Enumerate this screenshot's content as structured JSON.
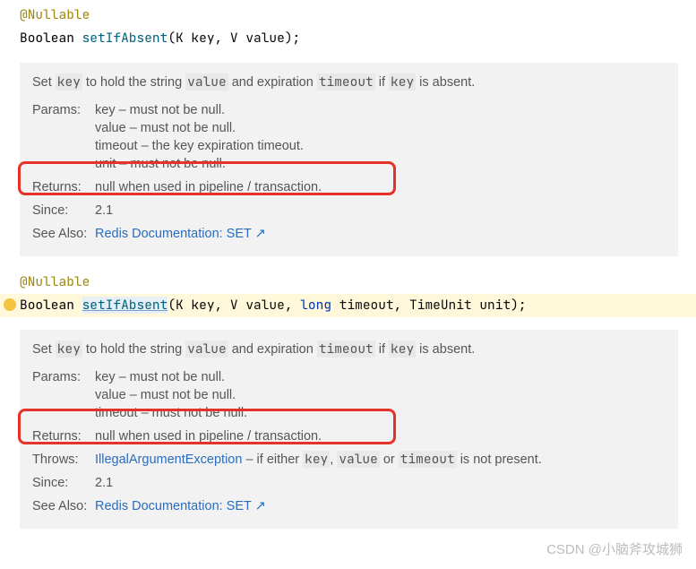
{
  "sig1": {
    "annotation": "@Nullable",
    "ret": "Boolean ",
    "method": "setIfAbsent",
    "open": "(",
    "p1t": "K",
    "p1n": " key, ",
    "p2t": "V",
    "p2n": " value",
    "close": ");"
  },
  "doc1": {
    "summary_pre": "Set ",
    "summary_k": "key",
    "summary_mid1": " to hold the string ",
    "summary_v": "value",
    "summary_mid2": " and expiration ",
    "summary_t": "timeout",
    "summary_mid3": " if ",
    "summary_k2": "key",
    "summary_end": " is absent.",
    "params_label": "Params:",
    "params_l1": "key – must not be null.",
    "params_l2": "value – must not be null.",
    "params_l3": "timeout – the key expiration timeout.",
    "params_l4": "unit – must not be null.",
    "returns_label": "Returns:",
    "returns_text": "null when used in pipeline / transaction.",
    "since_label": "Since:",
    "since_text": "2.1",
    "seealso_label": "See Also:",
    "seealso_link": "Redis Documentation: SET",
    "seealso_arrow": "↗"
  },
  "sig2": {
    "annotation": "@Nullable",
    "ret": "Boolean ",
    "method": "setIfAbsent",
    "open": "(",
    "p1t": "K",
    "p1n": " key, ",
    "p2t": "V",
    "p2n": " value, ",
    "p3t": "long",
    "p3n": " timeout, ",
    "p4t": "TimeUnit",
    "p4n": " unit",
    "close": ");"
  },
  "doc2": {
    "summary_pre": "Set ",
    "summary_k": "key",
    "summary_mid1": " to hold the string ",
    "summary_v": "value",
    "summary_mid2": " and expiration ",
    "summary_t": "timeout",
    "summary_mid3": " if ",
    "summary_k2": "key",
    "summary_end": " is absent.",
    "params_label": "Params:",
    "params_l1": "key – must not be null.",
    "params_l2": "value – must not be null.",
    "params_l3": "timeout – must not be null.",
    "returns_label": "Returns:",
    "returns_text": "null when used in pipeline / transaction.",
    "throws_label": "Throws:",
    "throws_pre": "IllegalArgumentException",
    "throws_mid": " – if either ",
    "throws_k": "key",
    "throws_c1": ", ",
    "throws_v": "value",
    "throws_c2": " or ",
    "throws_t": "timeout",
    "throws_end": " is not present.",
    "since_label": "Since:",
    "since_text": "2.1",
    "seealso_label": "See Also:",
    "seealso_link": "Redis Documentation: SET",
    "seealso_arrow": "↗"
  },
  "watermark": "CSDN @小脑斧攻城狮"
}
